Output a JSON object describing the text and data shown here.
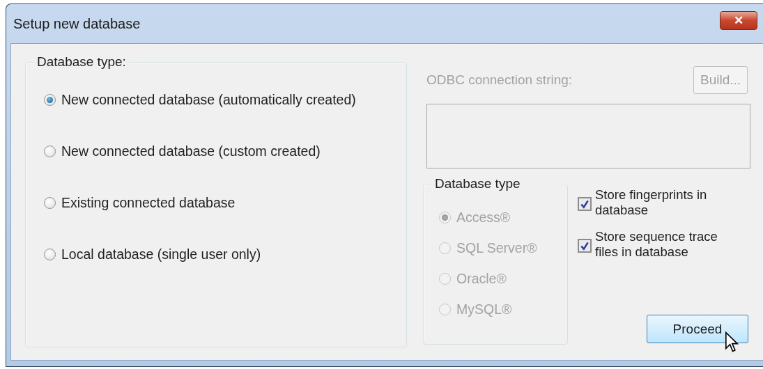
{
  "window": {
    "title": "Setup new database",
    "close_label": "✕"
  },
  "database_type_group": {
    "title": "Database type:",
    "options": [
      {
        "label": "New connected database (automatically created)",
        "selected": true
      },
      {
        "label": "New connected database (custom created)",
        "selected": false
      },
      {
        "label": "Existing connected database",
        "selected": false
      },
      {
        "label": "Local database (single user only)",
        "selected": false
      }
    ]
  },
  "odbc": {
    "label": "ODBC connection string:",
    "disabled": true,
    "build_button": {
      "label": "Build...",
      "disabled": true
    }
  },
  "server_type_group": {
    "title": "Database type",
    "disabled": true,
    "options": [
      {
        "label": "Access®",
        "selected": true
      },
      {
        "label": "SQL Server®",
        "selected": false
      },
      {
        "label": "Oracle®",
        "selected": false
      },
      {
        "label": "MySQL®",
        "selected": false
      }
    ]
  },
  "checkboxes": [
    {
      "label": "Store fingerprints in database",
      "checked": true
    },
    {
      "label": "Store sequence trace files in database",
      "checked": true
    }
  ],
  "proceed_button": {
    "label": "Proceed",
    "hovered": true
  }
}
